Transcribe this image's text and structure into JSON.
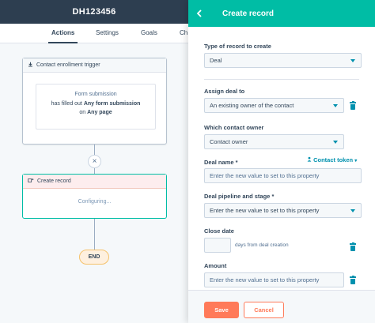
{
  "workflow": {
    "title": "DH123456",
    "tabs": [
      {
        "label": "Actions",
        "active": true
      },
      {
        "label": "Settings",
        "active": false
      },
      {
        "label": "Goals",
        "active": false
      },
      {
        "label": "Ch",
        "active": false
      }
    ],
    "trigger": {
      "header": "Contact enrollment trigger",
      "line1": "Form submission",
      "line2_prefix": "has filled out ",
      "line2_bold": "Any form submission",
      "line3_prefix": "on ",
      "line3_bold": "Any page"
    },
    "plus_symbol": "×",
    "create_action": {
      "header": "Create record",
      "status": "Configuring..."
    },
    "end_label": "END"
  },
  "panel": {
    "title": "Create record",
    "back_icon": "chevron-left-icon",
    "fields": {
      "record_type": {
        "label": "Type of record to create",
        "value": "Deal"
      },
      "assign_deal": {
        "label": "Assign deal to",
        "value": "An existing owner of the contact"
      },
      "contact_owner": {
        "label": "Which contact owner",
        "value": "Contact owner"
      },
      "deal_name": {
        "label": "Deal name *",
        "placeholder": "Enter the new value to set to this property",
        "token_link": "Contact token"
      },
      "pipeline_stage": {
        "label": "Deal pipeline and stage *",
        "value": "Enter the new value to set to this property"
      },
      "close_date": {
        "label": "Close date",
        "value": "",
        "helper": "days from deal creation"
      },
      "amount": {
        "label": "Amount",
        "placeholder": "Enter the new value to set to this property"
      }
    },
    "footer": {
      "save_label": "Save",
      "cancel_label": "Cancel"
    }
  },
  "colors": {
    "topbar": "#2d3e50",
    "accent_teal": "#00bda5",
    "link_blue": "#0091ae",
    "orange": "#ff7a59"
  }
}
